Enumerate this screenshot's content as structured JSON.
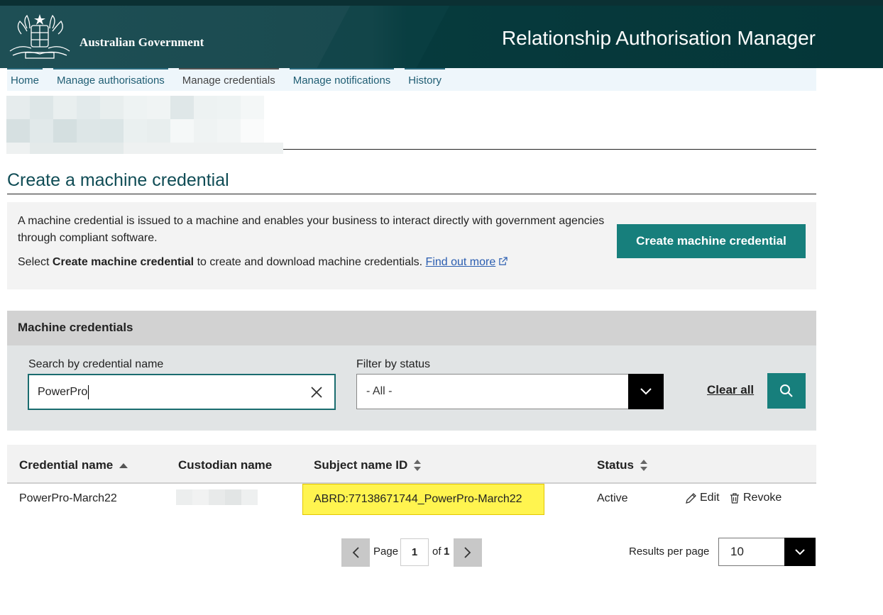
{
  "header": {
    "government_name": "Australian Government",
    "app_title": "Relationship Authorisation Manager"
  },
  "nav": {
    "items": [
      {
        "label": "Home"
      },
      {
        "label": "Manage authorisations"
      },
      {
        "label": "Manage credentials",
        "active": true
      },
      {
        "label": "Manage notifications"
      },
      {
        "label": "History"
      }
    ]
  },
  "page": {
    "title": "Create a machine credential"
  },
  "info": {
    "description": "A machine credential is issued to a machine and enables your business to interact directly with government agencies through compliant software.",
    "select_prefix": "Select ",
    "select_bold": "Create machine credential",
    "select_suffix": " to create and download machine credentials. ",
    "find_out_more": "Find out more",
    "create_button": "Create machine credential"
  },
  "credentials": {
    "section_title": "Machine credentials",
    "search_label": "Search by credential name",
    "search_value": "PowerPro",
    "filter_label": "Filter by status",
    "filter_value": "- All -",
    "clear_all": "Clear all",
    "columns": {
      "credential_name": "Credential name",
      "custodian_name": "Custodian name",
      "subject_name_id": "Subject name ID",
      "status": "Status"
    },
    "rows": [
      {
        "credential_name": "PowerPro-March22",
        "subject_name_id": "ABRD:77138671744_PowerPro-March22",
        "status": "Active",
        "edit": "Edit",
        "revoke": "Revoke"
      }
    ]
  },
  "pagination": {
    "page_label": "Page",
    "current_page": "1",
    "of_label": "of",
    "total_pages": "1",
    "results_per_page_label": "Results per page",
    "results_per_page": "10"
  },
  "colors": {
    "header_dark": "#063a3d",
    "accent_teal": "#177f7c",
    "highlight": "#fff44f"
  }
}
